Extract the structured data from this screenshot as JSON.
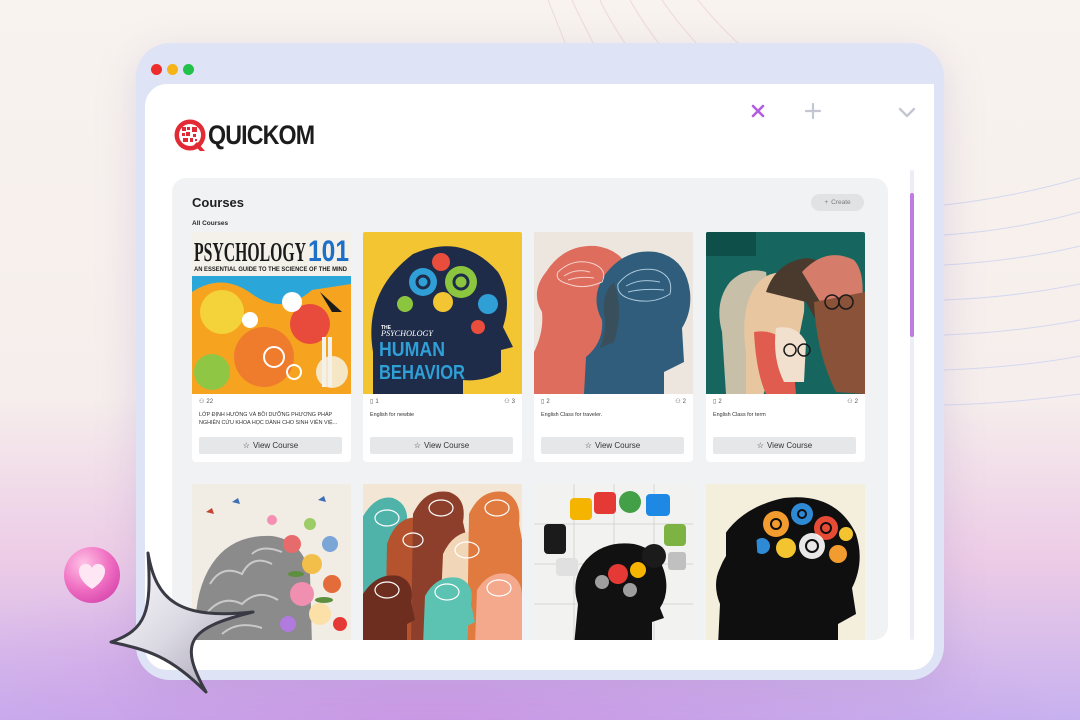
{
  "app": {
    "brand": "QUICKOM",
    "accent_color": "#c07ae3",
    "window_controls": [
      "close-dot",
      "minimize-dot",
      "maximize-dot"
    ]
  },
  "tabs": {
    "close_icon": "close-icon",
    "new_tab_icon": "plus-icon",
    "menu_icon": "chevron-down-icon"
  },
  "panel": {
    "title": "Courses",
    "subtitle": "All Courses",
    "create_label": "Create",
    "create_icon": "plus-icon"
  },
  "courses": [
    {
      "cover": "psychology-101-cover",
      "cover_title": "PSYCHOLOGY",
      "cover_number": "101",
      "cover_subtitle": "AN ESSENTIAL GUIDE TO THE SCIENCE OF THE MIND",
      "lessons": "",
      "members": "22",
      "description": "LỚP ĐỊNH HƯỚNG VÀ BỒI DƯỠNG PHƯƠNG PHÁP NGHIÊN CỨU KHOA HỌC DÀNH CHO SINH VIÊN VIỆ...",
      "button": "View Course"
    },
    {
      "cover": "human-behavior-cover",
      "cover_title_1": "THE",
      "cover_title_2": "PSYCHOLOGY",
      "cover_title_3": "HUMAN",
      "cover_title_4": "BEHAVIOR",
      "lessons": "1",
      "members": "3",
      "description": "English for newbie",
      "button": "View Course"
    },
    {
      "cover": "two-heads-cover",
      "lessons": "2",
      "members": "2",
      "description": "English Class for traveler.",
      "button": "View Course"
    },
    {
      "cover": "faces-collage-cover",
      "lessons": "2",
      "members": "2",
      "description": "English Class for term",
      "button": "View Course"
    },
    {
      "cover": "floral-brain-cover"
    },
    {
      "cover": "colorful-heads-cover"
    },
    {
      "cover": "gears-icons-head-cover"
    },
    {
      "cover": "gear-brain-silhouette-cover"
    }
  ]
}
